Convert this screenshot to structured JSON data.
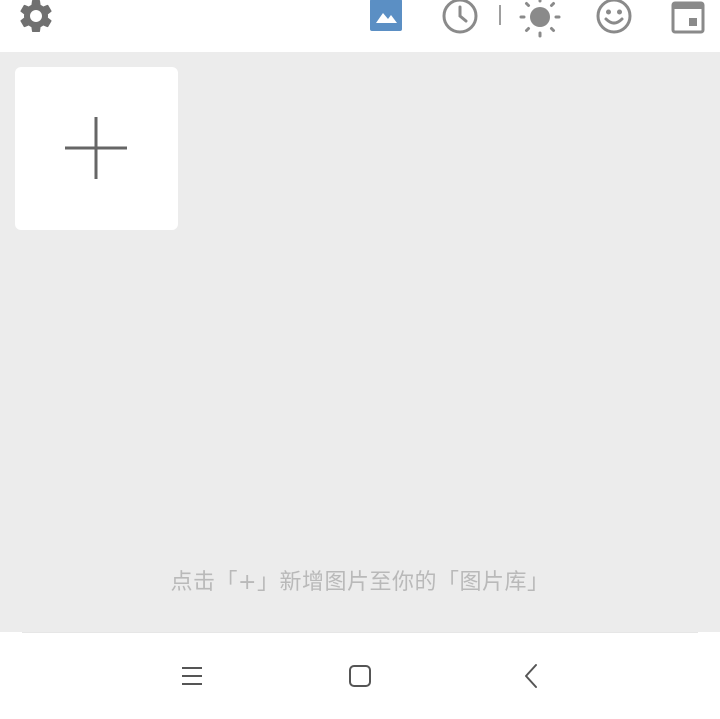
{
  "toolbar": {
    "icons": [
      "gear-icon",
      "image-icon",
      "clock-icon",
      "sun-icon",
      "smiley-icon",
      "calendar-icon"
    ],
    "active_tab": "image",
    "colors": {
      "icon": "#707070",
      "active": "#5b8fc4"
    }
  },
  "gallery": {
    "add_icon": "plus-icon",
    "hint": "点击「+」新增图片至你的「图片库」"
  },
  "navbar": {
    "icons": [
      "menu-icon",
      "home-icon",
      "back-icon"
    ]
  }
}
